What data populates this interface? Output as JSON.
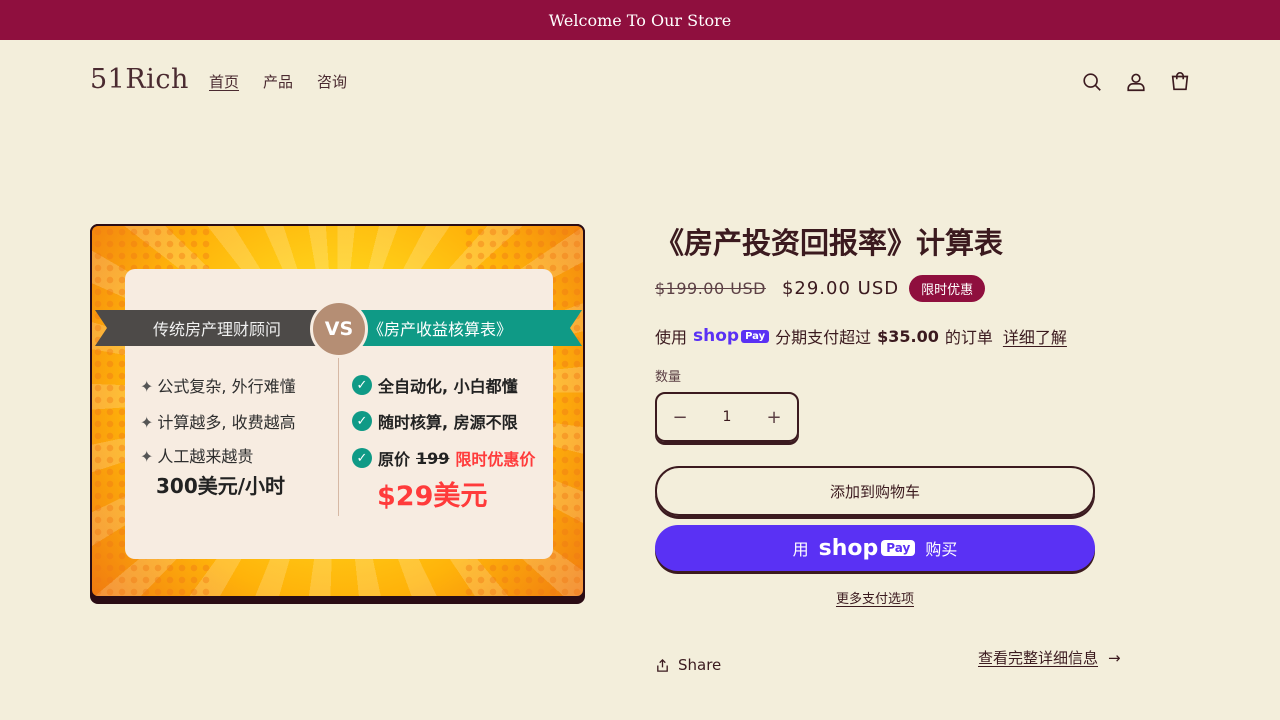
{
  "announcement": "Welcome To Our Store",
  "header": {
    "logo": "51Rich",
    "nav": [
      "首页",
      "产品",
      "咨询"
    ],
    "icons": [
      "search-icon",
      "account-icon",
      "cart-icon"
    ]
  },
  "image": {
    "left_header": "传统房产理财顾问",
    "vs": "VS",
    "right_header": "《房产收益核算表》",
    "left_items": [
      "公式复杂, 外行难懂",
      "计算越多, 收费越高",
      "人工越来越贵"
    ],
    "left_big": "300美元/小时",
    "right_items": [
      "全自动化, 小白都懂",
      "随时核算, 房源不限"
    ],
    "right_price_orig_label": "原价",
    "right_price_orig_value": "199",
    "right_price_promo": "限时优惠价",
    "right_big": "$29美元"
  },
  "product": {
    "title": "《房产投资回报率》计算表",
    "price_old": "$199.00 USD",
    "price_new": "$29.00 USD",
    "badge": "限时优惠",
    "install_prefix": "使用",
    "install_brand": "shop",
    "install_brand_pay": "Pay",
    "install_text": "分期支付超过",
    "install_amount": "$35.00",
    "install_suffix": "的订单",
    "install_link": "详细了解",
    "qty_label": "数量",
    "qty_minus": "−",
    "qty_value": "1",
    "qty_plus": "+",
    "add_to_cart": "添加到购物车",
    "shoppay_prefix": "用",
    "shoppay_brand": "shop",
    "shoppay_brand_pay": "Pay",
    "shoppay_suffix": "购买",
    "more_payment": "更多支付选项",
    "share": "Share",
    "details_link": "查看完整详细信息",
    "details_arrow": "→"
  },
  "colors": {
    "background": "#f3eedb",
    "accent": "#8f0f3e",
    "text": "#3b1a1f",
    "shoppay": "#5a31f4"
  }
}
